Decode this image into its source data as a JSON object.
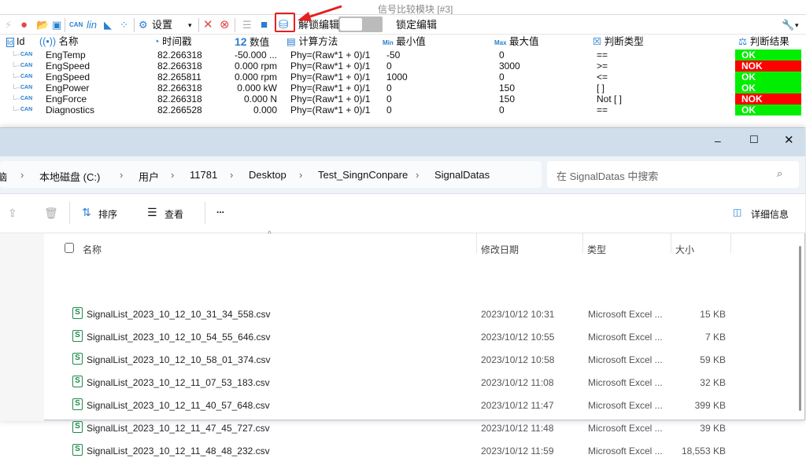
{
  "app": {
    "title": "信号比较模块 [#3]",
    "toolbar": {
      "settings_label": "设置",
      "unlock_label": "解锁编辑",
      "lock_label": "锁定编辑"
    },
    "columns": [
      "Id",
      "名称",
      "时间戳",
      "数值",
      "计算方法",
      "最小值",
      "最大值",
      "判断类型",
      "判断结果"
    ],
    "column_icon_labels": {
      "value": "12",
      "min": "Min",
      "max": "Max"
    },
    "rows": [
      {
        "name": "EngTemp",
        "timestamp": "82.266318",
        "value": "-50.000 ...",
        "method": "Phy=(Raw*1 + 0)/1",
        "min": "-50",
        "max": "0",
        "type": "==",
        "result": "OK"
      },
      {
        "name": "EngSpeed",
        "timestamp": "82.266318",
        "value": "0.000 rpm",
        "method": "Phy=(Raw*1 + 0)/1",
        "min": "0",
        "max": "3000",
        "type": ">=",
        "result": "NOK"
      },
      {
        "name": "EngSpeed",
        "timestamp": "82.265811",
        "value": "0.000 rpm",
        "method": "Phy=(Raw*1 + 0)/1",
        "min": "1000",
        "max": "0",
        "type": "<=",
        "result": "OK"
      },
      {
        "name": "EngPower",
        "timestamp": "82.266318",
        "value": "0.000 kW",
        "method": "Phy=(Raw*1 + 0)/1",
        "min": "0",
        "max": "150",
        "type": "[ ]",
        "result": "OK"
      },
      {
        "name": "EngForce",
        "timestamp": "82.266318",
        "value": "0.000 N",
        "method": "Phy=(Raw*1 + 0)/1",
        "min": "0",
        "max": "150",
        "type": "Not [ ]",
        "result": "NOK"
      },
      {
        "name": "Diagnostics",
        "timestamp": "82.266528",
        "value": "0.000",
        "method": "Phy=(Raw*1 + 0)/1",
        "min": "0",
        "max": "0",
        "type": "==",
        "result": "OK"
      }
    ],
    "colors": {
      "ok": "#00ee00",
      "nok": "#ff0000",
      "highlight": "#e52020"
    }
  },
  "explorer": {
    "breadcrumb": [
      "脑",
      "本地磁盘 (C:)",
      "用户",
      "11781",
      "Desktop",
      "Test_SingnConpare",
      "SignalDatas"
    ],
    "search_placeholder": "在 SignalDatas 中搜索",
    "toolbar": {
      "sort": "排序",
      "view": "查看",
      "more": "...",
      "details": "详细信息"
    },
    "columns": [
      "名称",
      "修改日期",
      "类型",
      "大小"
    ],
    "files": [
      {
        "name": "SignalList_2023_10_12_10_31_34_558.csv",
        "date": "2023/10/12 10:31",
        "type": "Microsoft Excel ...",
        "size": "15 KB"
      },
      {
        "name": "SignalList_2023_10_12_10_54_55_646.csv",
        "date": "2023/10/12 10:55",
        "type": "Microsoft Excel ...",
        "size": "7 KB"
      },
      {
        "name": "SignalList_2023_10_12_10_58_01_374.csv",
        "date": "2023/10/12 10:58",
        "type": "Microsoft Excel ...",
        "size": "59 KB"
      },
      {
        "name": "SignalList_2023_10_12_11_07_53_183.csv",
        "date": "2023/10/12 11:08",
        "type": "Microsoft Excel ...",
        "size": "32 KB"
      },
      {
        "name": "SignalList_2023_10_12_11_40_57_648.csv",
        "date": "2023/10/12 11:47",
        "type": "Microsoft Excel ...",
        "size": "399 KB"
      },
      {
        "name": "SignalList_2023_10_12_11_47_45_727.csv",
        "date": "2023/10/12 11:48",
        "type": "Microsoft Excel ...",
        "size": "39 KB"
      },
      {
        "name": "SignalList_2023_10_12_11_48_48_232.csv",
        "date": "2023/10/12 11:59",
        "type": "Microsoft Excel ...",
        "size": "18,553 KB"
      }
    ]
  }
}
